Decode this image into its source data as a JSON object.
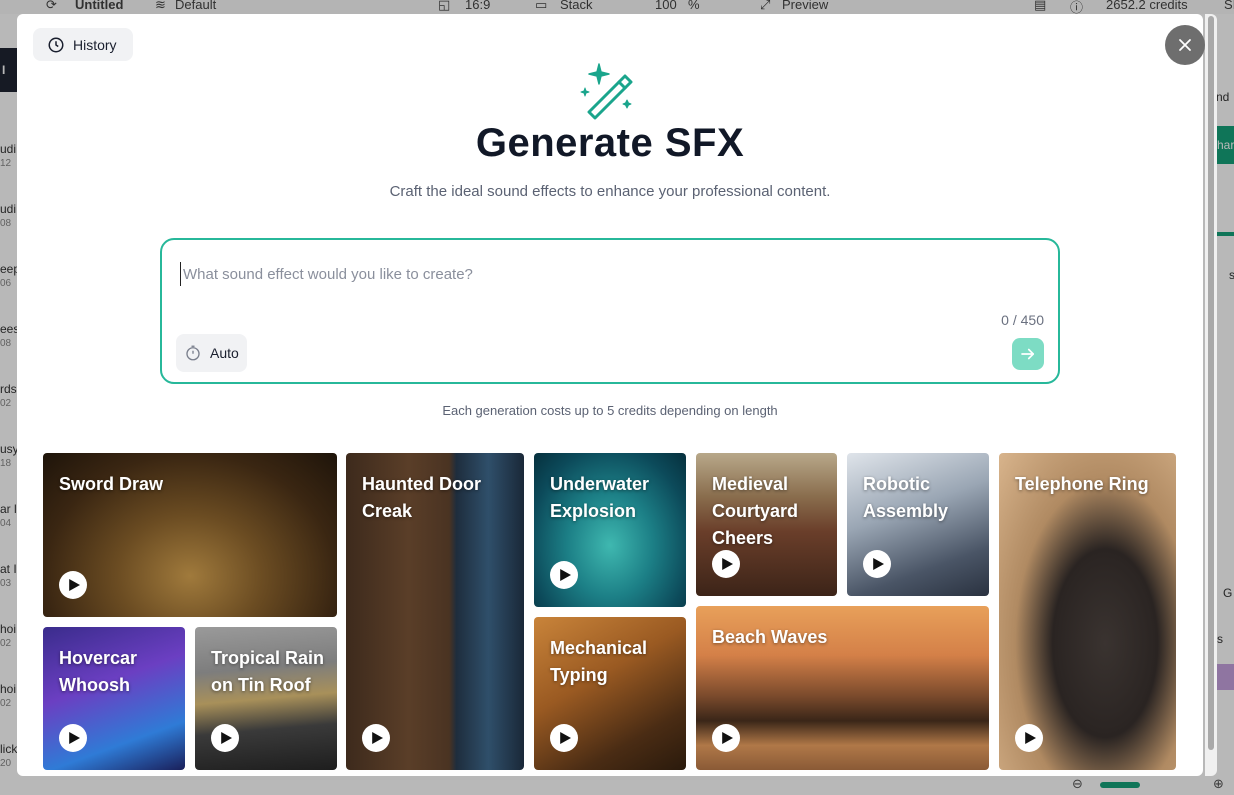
{
  "background": {
    "topbar": {
      "project_name": "Untitled",
      "theme": "Default",
      "ratio": "16:9",
      "layout": "Stack",
      "zoom": "100",
      "zoom_unit": "%",
      "preview": "Preview",
      "credits": "2652.2 credits",
      "extra": "SI"
    },
    "left_rows": [
      {
        "label": "udi",
        "sub": "12"
      },
      {
        "label": "udi",
        "sub": "08"
      },
      {
        "label": "eep",
        "sub": "06"
      },
      {
        "label": "ees",
        "sub": "08"
      },
      {
        "label": "rds",
        "sub": "02"
      },
      {
        "label": "usy",
        "sub": "18"
      },
      {
        "label": "ar l",
        "sub": "04"
      },
      {
        "label": "at I",
        "sub": "03"
      },
      {
        "label": "hoi",
        "sub": "02"
      },
      {
        "label": "hoi",
        "sub": "02"
      },
      {
        "label": "lick",
        "sub": "20"
      }
    ],
    "left_header": "I SI",
    "right_labels": [
      "nd",
      "har",
      "s",
      "G",
      "s"
    ]
  },
  "modal": {
    "history_label": "History",
    "title": "Generate SFX",
    "subtitle": "Craft the ideal sound effects to enhance your professional content.",
    "prompt": {
      "placeholder": "What sound effect would you like to create?",
      "value": "",
      "counter": "0 / 450",
      "duration_label": "Auto"
    },
    "cost_note": "Each generation costs up to 5 credits depending on length",
    "accent_color": "#27b89a",
    "presets": [
      {
        "id": "sword",
        "label": "Sword Draw"
      },
      {
        "id": "hovercar",
        "label": "Hovercar Whoosh"
      },
      {
        "id": "rain",
        "label": "Tropical Rain on Tin Roof"
      },
      {
        "id": "door",
        "label": "Haunted Door Creak"
      },
      {
        "id": "underwater",
        "label": "Underwater Explosion"
      },
      {
        "id": "typing",
        "label": "Mechanical Typing"
      },
      {
        "id": "medieval",
        "label": "Medieval Courtyard Cheers"
      },
      {
        "id": "robotic",
        "label": "Robotic Assembly"
      },
      {
        "id": "beach",
        "label": "Beach Waves"
      },
      {
        "id": "telephone",
        "label": "Telephone Ring"
      }
    ]
  }
}
